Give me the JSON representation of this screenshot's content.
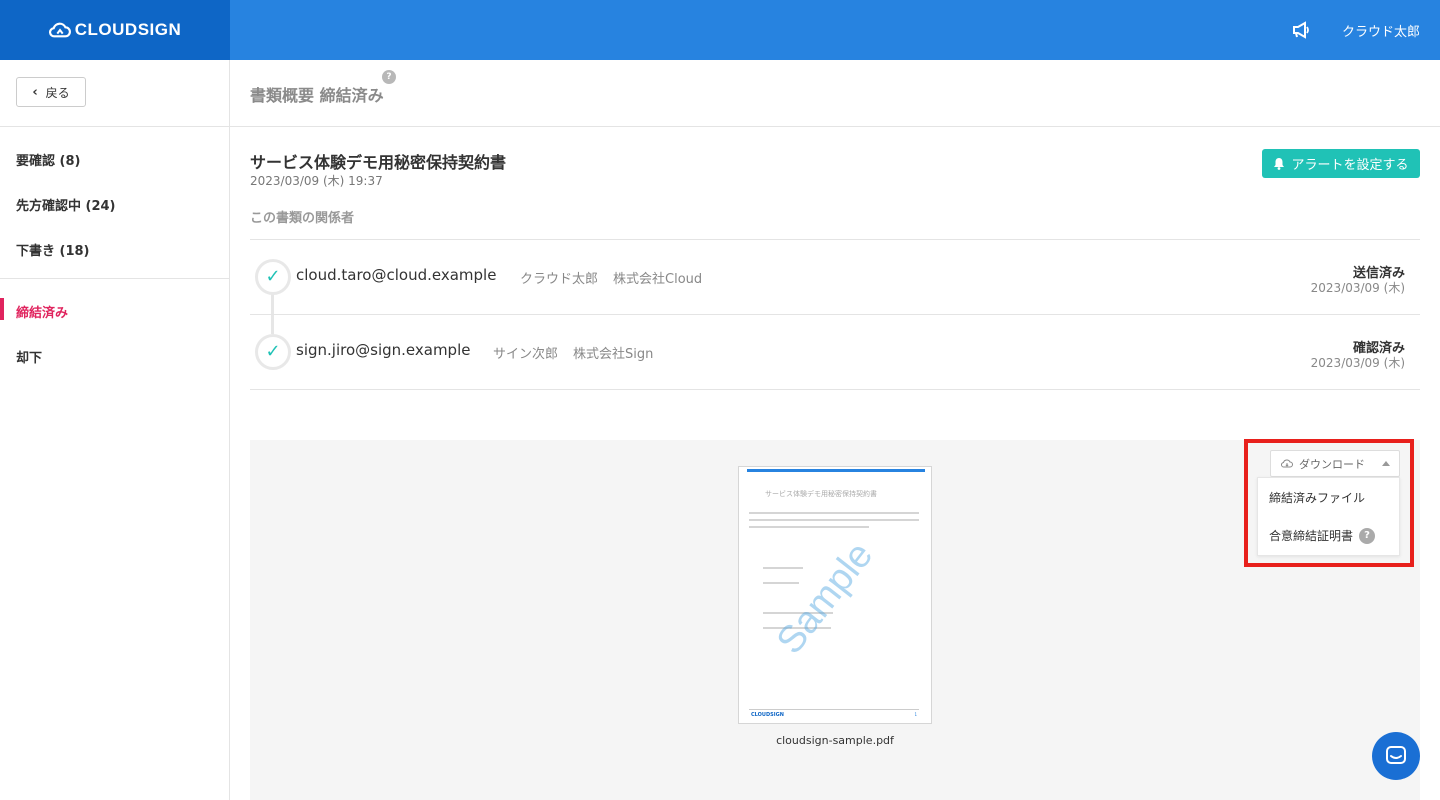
{
  "header": {
    "logo_text": "CLOUDSIGN",
    "user_name": "クラウド太郎",
    "icons": {
      "logo": "cloudsign-cloud-icon",
      "announce": "megaphone-icon"
    }
  },
  "sidebar": {
    "back_label": "戻る",
    "items": [
      {
        "label": "要確認 (8)"
      },
      {
        "label": "先方確認中 (24)"
      },
      {
        "label": "下書き (18)"
      },
      {
        "label": "締結済み",
        "active": true
      },
      {
        "label": "却下"
      }
    ]
  },
  "page": {
    "title": "書類概要 締結済み",
    "help": "?"
  },
  "document": {
    "title": "サービス体験デモ用秘密保持契約書",
    "date": "2023/03/09 (木) 19:37",
    "alert_button": "アラートを設定する",
    "related_title": "この書類の関係者"
  },
  "parties": [
    {
      "email": "cloud.taro@cloud.example",
      "name": "クラウド太郎",
      "company": "株式会社Cloud",
      "status": "送信済み",
      "status_date": "2023/03/09 (木)"
    },
    {
      "email": "sign.jiro@sign.example",
      "name": "サイン次郎",
      "company": "株式会社Sign",
      "status": "確認済み",
      "status_date": "2023/03/09 (木)"
    }
  ],
  "preview": {
    "pdf_title": "サービス体験デモ用秘密保持契約書",
    "watermark": "Sample",
    "footer_logo": "CLOUDSIGN",
    "page_number": "1",
    "filename": "cloudsign-sample.pdf"
  },
  "download": {
    "toggle_label": "ダウンロード",
    "items": [
      {
        "label": "締結済みファイル"
      },
      {
        "label": "合意締結証明書",
        "help": "?"
      }
    ]
  },
  "colors": {
    "header": "#2783e0",
    "logo_bg": "#0e66c6",
    "accent_teal": "#20c2b6",
    "active_pink": "#e0245e",
    "highlight_red": "#e8201c"
  }
}
